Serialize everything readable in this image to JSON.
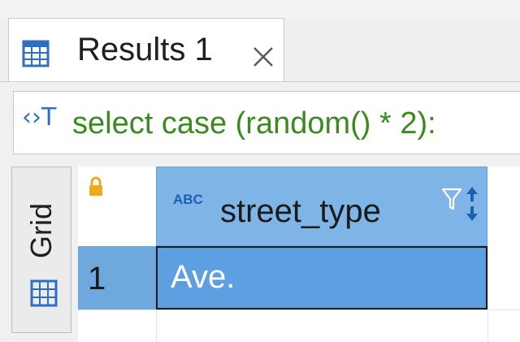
{
  "tab": {
    "label": "Results 1",
    "icon": "table-grid-icon",
    "close_icon": "close-icon"
  },
  "sql": {
    "icon_glyph": "‹›T",
    "icon": "sql-text-icon",
    "text": "select case (random() * 2):"
  },
  "view_switcher": {
    "label": "Grid",
    "icon": "grid-icon"
  },
  "grid": {
    "lock_icon": "lock-icon",
    "columns": [
      {
        "type_badge": "ABC",
        "label": "street_type",
        "filter_icon": "filter-icon",
        "sort_icon": "sort-icon"
      }
    ],
    "rows": [
      {
        "num": "1",
        "cells": [
          "Ave."
        ]
      }
    ]
  },
  "colors": {
    "header_blue": "#7fb5e6",
    "selected_cell": "#5d9fe0",
    "sql_green": "#3b8a1f",
    "icon_blue": "#2f6fbf",
    "lock_gold": "#f0a81c"
  }
}
